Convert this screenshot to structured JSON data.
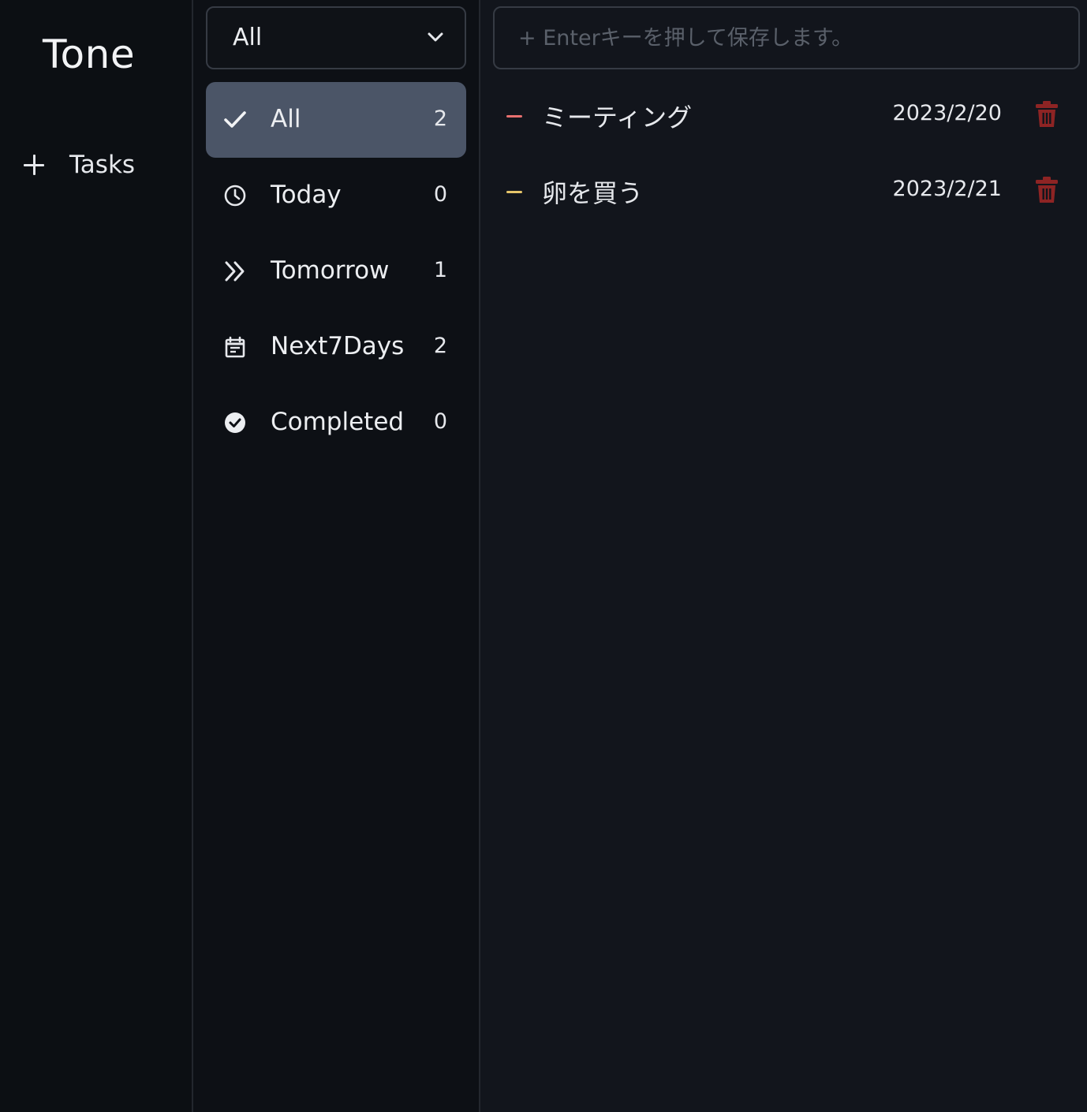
{
  "app": {
    "title": "Tone"
  },
  "sidebar": {
    "items": [
      {
        "label": "Tasks",
        "icon": "plus-icon"
      }
    ]
  },
  "filter_select": {
    "selected": "All"
  },
  "filters": [
    {
      "label": "All",
      "count": "2",
      "icon": "check-icon",
      "active": true
    },
    {
      "label": "Today",
      "count": "0",
      "icon": "clock-icon",
      "active": false
    },
    {
      "label": "Tomorrow",
      "count": "1",
      "icon": "double-chevron-right-icon",
      "active": false
    },
    {
      "label": "Next7Days",
      "count": "2",
      "icon": "calendar-icon",
      "active": false
    },
    {
      "label": "Completed",
      "count": "0",
      "icon": "check-circle-icon",
      "active": false
    }
  ],
  "task_input": {
    "placeholder": "+ Enterキーを押して保存します。"
  },
  "tasks": [
    {
      "name": "ミーティング",
      "date": "2023/2/20",
      "priority_color": "#e8706f"
    },
    {
      "name": "卵を買う",
      "date": "2023/2/21",
      "priority_color": "#e6c56a"
    }
  ],
  "colors": {
    "background": "#0d1014",
    "active_filter": "#4b5567",
    "trash": "#8e2424",
    "text": "#e6e8ec"
  }
}
